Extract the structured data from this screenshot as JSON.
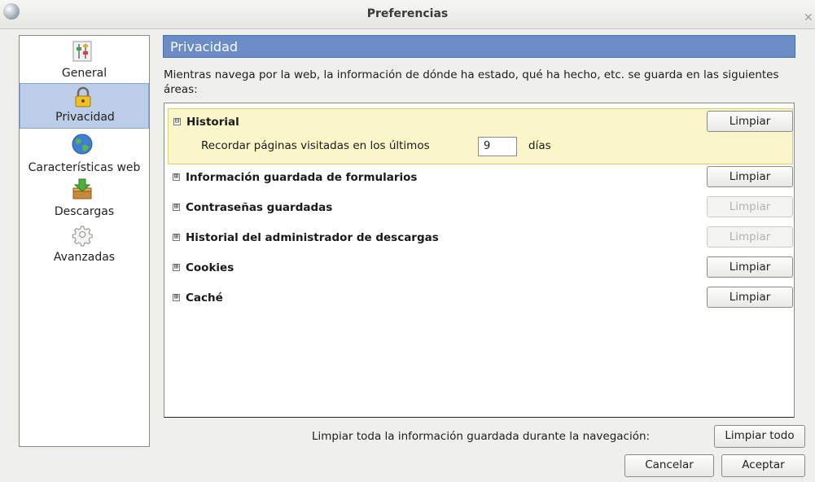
{
  "window": {
    "title": "Preferencias"
  },
  "sidebar": {
    "items": [
      {
        "label": "General",
        "icon": "sliders-icon"
      },
      {
        "label": "Privacidad",
        "icon": "padlock-icon",
        "selected": true
      },
      {
        "label": "Características web",
        "icon": "globe-icon"
      },
      {
        "label": "Descargas",
        "icon": "download-box-icon"
      },
      {
        "label": "Avanzadas",
        "icon": "gear-icon"
      }
    ]
  },
  "main": {
    "header": "Privacidad",
    "description": "Mientras navega por la web, la información de dónde ha estado, qué ha hecho, etc. se guarda en las siguientes áreas:",
    "sections": [
      {
        "name": "Historial",
        "expanded": true,
        "twisty": "⊟",
        "button": "Limpiar",
        "enabled": true
      },
      {
        "name": "Información guardada de formularios",
        "twisty": "⊞",
        "button": "Limpiar",
        "enabled": true
      },
      {
        "name": "Contraseñas guardadas",
        "twisty": "⊞",
        "button": "Limpiar",
        "enabled": false
      },
      {
        "name": "Historial del administrador de descargas",
        "twisty": "⊞",
        "button": "Limpiar",
        "enabled": false
      },
      {
        "name": "Cookies",
        "twisty": "⊞",
        "button": "Limpiar",
        "enabled": true
      },
      {
        "name": "Caché",
        "twisty": "⊞",
        "button": "Limpiar",
        "enabled": true
      }
    ],
    "history": {
      "remember_label": "Recordar páginas visitadas en los últimos",
      "days_value": "9",
      "days_unit": "días"
    }
  },
  "footer": {
    "clear_all_label": "Limpiar toda la información guardada durante la navegación:",
    "clear_all_button": "Limpiar todo",
    "cancel": "Cancelar",
    "accept": "Aceptar"
  },
  "colors": {
    "header_bg": "#6b8cc7",
    "selected_bg": "#bccde8",
    "expanded_bg": "#fbf6c9"
  }
}
